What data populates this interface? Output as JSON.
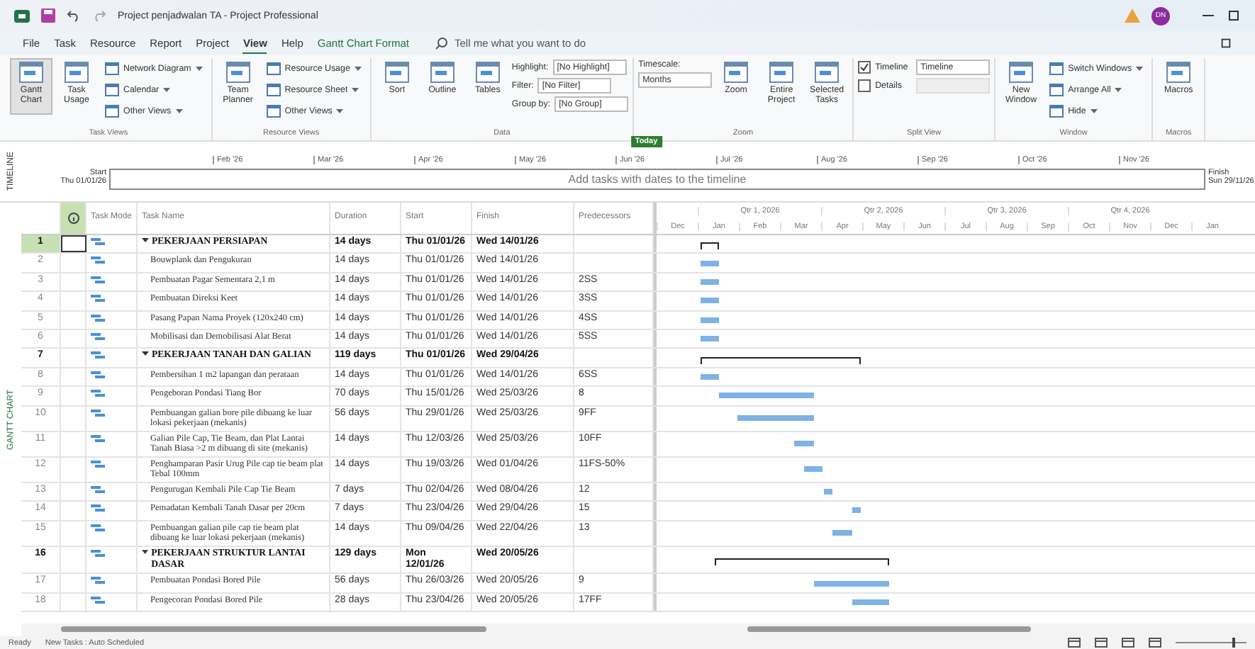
{
  "title_bar": {
    "title": "Project penjadwalan TA  -  Project Professional",
    "user_initials": "DN"
  },
  "menu_tabs": [
    {
      "label": "File",
      "kind": "tab",
      "selected": false
    },
    {
      "label": "Task",
      "kind": "tab",
      "selected": false
    },
    {
      "label": "Resource",
      "kind": "tab",
      "selected": false
    },
    {
      "label": "Report",
      "kind": "tab",
      "selected": false
    },
    {
      "label": "Project",
      "kind": "tab",
      "selected": false
    },
    {
      "label": "View",
      "kind": "tab",
      "selected": true
    },
    {
      "label": "Help",
      "kind": "tab",
      "selected": false
    },
    {
      "label": "Gantt Chart Format",
      "kind": "contextual",
      "selected": false
    }
  ],
  "tell_me": {
    "placeholder": "Tell me what you want to do"
  },
  "ribbon": [
    {
      "label": "Task Views",
      "items": [
        {
          "kind": "large",
          "label": "Gantt Chart",
          "selected": true
        },
        {
          "kind": "large",
          "label": "Task Usage",
          "selected": false
        },
        {
          "kind": "stack",
          "items": [
            {
              "kind": "small",
              "label": "Network Diagram"
            },
            {
              "kind": "small",
              "label": "Calendar"
            },
            {
              "kind": "small",
              "label": "Other Views"
            }
          ]
        }
      ]
    },
    {
      "label": "Resource Views",
      "items": [
        {
          "kind": "large",
          "label": "Team Planner",
          "selected": false
        },
        {
          "kind": "stack",
          "items": [
            {
              "kind": "small",
              "label": "Resource Usage"
            },
            {
              "kind": "small",
              "label": "Resource Sheet"
            },
            {
              "kind": "small",
              "label": "Other Views"
            }
          ]
        }
      ]
    },
    {
      "label": "Data",
      "items": [
        {
          "kind": "large",
          "label": "Sort",
          "selected": false
        },
        {
          "kind": "large",
          "label": "Outline",
          "selected": false
        },
        {
          "kind": "large",
          "label": "Tables",
          "selected": false
        },
        {
          "kind": "stack",
          "items": [
            {
              "kind": "field",
              "label": "Highlight:",
              "value": "[No Highlight]"
            },
            {
              "kind": "field",
              "label": "Filter:",
              "value": "[No Filter]"
            },
            {
              "kind": "field",
              "label": "Group by:",
              "value": "[No Group]"
            }
          ]
        }
      ]
    },
    {
      "label": "Zoom",
      "items": [
        {
          "kind": "stack",
          "items": [
            {
              "kind": "label",
              "label": "Timescale:"
            },
            {
              "kind": "field",
              "value": "Months"
            }
          ]
        },
        {
          "kind": "large",
          "label": "Zoom",
          "selected": false
        },
        {
          "kind": "large",
          "label": "Entire Project",
          "selected": false
        },
        {
          "kind": "large",
          "label": "Selected Tasks",
          "selected": false
        }
      ]
    },
    {
      "label": "Split View",
      "items": [
        {
          "kind": "stack",
          "items": [
            {
              "kind": "check",
              "label": "Timeline",
              "checked": true,
              "value": "Timeline"
            },
            {
              "kind": "check",
              "label": "Details",
              "checked": false
            }
          ]
        }
      ]
    },
    {
      "label": "Window",
      "items": [
        {
          "kind": "large",
          "label": "New Window",
          "selected": false
        },
        {
          "kind": "stack",
          "items": [
            {
              "kind": "small",
              "label": "Switch Windows"
            },
            {
              "kind": "small",
              "label": "Arrange All"
            },
            {
              "kind": "small",
              "label": "Hide"
            }
          ]
        }
      ]
    },
    {
      "label": "Macros",
      "items": [
        {
          "kind": "large",
          "label": "Macros",
          "selected": false
        }
      ]
    }
  ],
  "timeline": {
    "side_label": "TIMELINE",
    "start_label": "Start",
    "start_date": "Thu 01/01/26",
    "finish_label": "Finish",
    "finish_date": "Sun 29/11/26",
    "placeholder": "Add tasks with dates to the timeline",
    "months": [
      "Feb '26",
      "Mar '26",
      "Apr '26",
      "May '26",
      "Jun '26",
      "Jul '26",
      "Aug '26",
      "Sep '26",
      "Oct '26",
      "Nov '26"
    ],
    "today": {
      "label": "Today",
      "level": 0.49
    }
  },
  "view_label": "GANTT CHART",
  "table": {
    "columns": [
      "Task Mode",
      "Task Name",
      "Duration",
      "Start",
      "Finish",
      "Predecessors"
    ],
    "rows": [
      {
        "id": "1",
        "kind": "summary",
        "selected": true,
        "name": "PEKERJAAN PERSIAPAN",
        "duration": "14 days",
        "start": "Thu 01/01/26",
        "finish": "Wed 14/01/26"
      },
      {
        "id": "2",
        "kind": "task",
        "selected": false,
        "name": "Bouwplank dan Pengukuran",
        "duration": "14 days",
        "start": "Thu 01/01/26",
        "finish": "Wed 14/01/26"
      },
      {
        "id": "3",
        "kind": "task",
        "selected": false,
        "name": "Pembuatan Pagar Sementara 2,1 m",
        "duration": "14 days",
        "start": "Thu 01/01/26",
        "finish": "Wed 14/01/26",
        "predecessors": "2SS"
      },
      {
        "id": "4",
        "kind": "task",
        "selected": false,
        "name": "Pembuatan Direksi Keet",
        "duration": "14 days",
        "start": "Thu 01/01/26",
        "finish": "Wed 14/01/26",
        "predecessors": "3SS"
      },
      {
        "id": "5",
        "kind": "task",
        "selected": false,
        "name": "Pasang Papan Nama Proyek (120x240 cm)",
        "duration": "14 days",
        "start": "Thu 01/01/26",
        "finish": "Wed 14/01/26",
        "predecessors": "4SS"
      },
      {
        "id": "6",
        "kind": "task",
        "selected": false,
        "name": "Mobilisasi dan Demobilisasi Alat Berat",
        "duration": "14 days",
        "start": "Thu 01/01/26",
        "finish": "Wed 14/01/26",
        "predecessors": "5SS"
      },
      {
        "id": "7",
        "kind": "summary",
        "selected": false,
        "name": "PEKERJAAN TANAH DAN GALIAN",
        "duration": "119 days",
        "start": "Thu 01/01/26",
        "finish": "Wed 29/04/26"
      },
      {
        "id": "8",
        "kind": "task",
        "selected": false,
        "name": "Pembersihan 1 m2 lapangan dan perataan",
        "duration": "14 days",
        "start": "Thu 01/01/26",
        "finish": "Wed 14/01/26",
        "predecessors": "6SS"
      },
      {
        "id": "9",
        "kind": "task",
        "selected": false,
        "name": "Pengeboran Pondasi Tiang Bor",
        "duration": "70 days",
        "start": "Thu 15/01/26",
        "finish": "Wed 25/03/26",
        "predecessors": "8"
      },
      {
        "id": "10",
        "kind": "task",
        "selected": false,
        "name": "Pembuangan galian bore pile dibuang ke luar lokasi pekerjaan (mekanis)",
        "duration": "56 days",
        "start": "Thu 29/01/26",
        "finish": "Wed 25/03/26",
        "predecessors": "9FF"
      },
      {
        "id": "11",
        "kind": "task",
        "selected": false,
        "name": "Galian Pile Cap, Tie Beam, dan Plat Lantai Tanah Biasa >2 m dibuang di site (mekanis)",
        "duration": "14 days",
        "start": "Thu 12/03/26",
        "finish": "Wed 25/03/26",
        "predecessors": "10FF"
      },
      {
        "id": "12",
        "kind": "task",
        "selected": false,
        "name": "Penghamparan Pasir Urug Pile cap tie beam plat Tebal 100mm",
        "duration": "14 days",
        "start": "Thu 19/03/26",
        "finish": "Wed 01/04/26",
        "predecessors": "11FS-50%"
      },
      {
        "id": "13",
        "kind": "task",
        "selected": false,
        "name": "Pengurugan Kembali Pile Cap Tie Beam",
        "duration": "7 days",
        "start": "Thu 02/04/26",
        "finish": "Wed 08/04/26",
        "predecessors": "12"
      },
      {
        "id": "14",
        "kind": "task",
        "selected": false,
        "name": "Pemadatan Kembali Tanah Dasar per 20cm",
        "duration": "7 days",
        "start": "Thu 23/04/26",
        "finish": "Wed 29/04/26",
        "predecessors": "15"
      },
      {
        "id": "15",
        "kind": "task",
        "selected": false,
        "name": "Pembuangan galian pile cap tie beam plat dibuang ke luar lokasi pekerjaan (mekanis)",
        "duration": "14 days",
        "start": "Thu 09/04/26",
        "finish": "Wed 22/04/26",
        "predecessors": "13"
      },
      {
        "id": "16",
        "kind": "summary",
        "selected": false,
        "name": "PEKERJAAN STRUKTUR LANTAI DASAR",
        "duration": "129 days",
        "start": "Mon 12/01/26",
        "finish": "Wed 20/05/26"
      },
      {
        "id": "17",
        "kind": "task",
        "selected": false,
        "name": "Pembuatan Pondasi Bored Pile",
        "duration": "56 days",
        "start": "Thu 26/03/26",
        "finish": "Wed 20/05/26",
        "predecessors": "9"
      },
      {
        "id": "18",
        "kind": "task",
        "selected": false,
        "name": "Pengecoran Pondasi Bored Pile",
        "duration": "28 days",
        "start": "Thu 23/04/26",
        "finish": "Wed 20/05/26",
        "predecessors": "17FF"
      }
    ]
  },
  "gantt": {
    "quarters": [
      "Qtr 1, 2026",
      "Qtr 2, 2026",
      "Qtr 3, 2026",
      "Qtr 4, 2026"
    ],
    "months": [
      "Dec",
      "Jan",
      "Feb",
      "Mar",
      "Apr",
      "May",
      "Jun",
      "Jul",
      "Aug",
      "Sep",
      "Oct",
      "Nov",
      "Dec",
      "Jan"
    ]
  },
  "status_bar": {
    "ready": "Ready",
    "mode": "New Tasks : Auto Scheduled",
    "zoom": {
      "level": 0.8
    }
  }
}
